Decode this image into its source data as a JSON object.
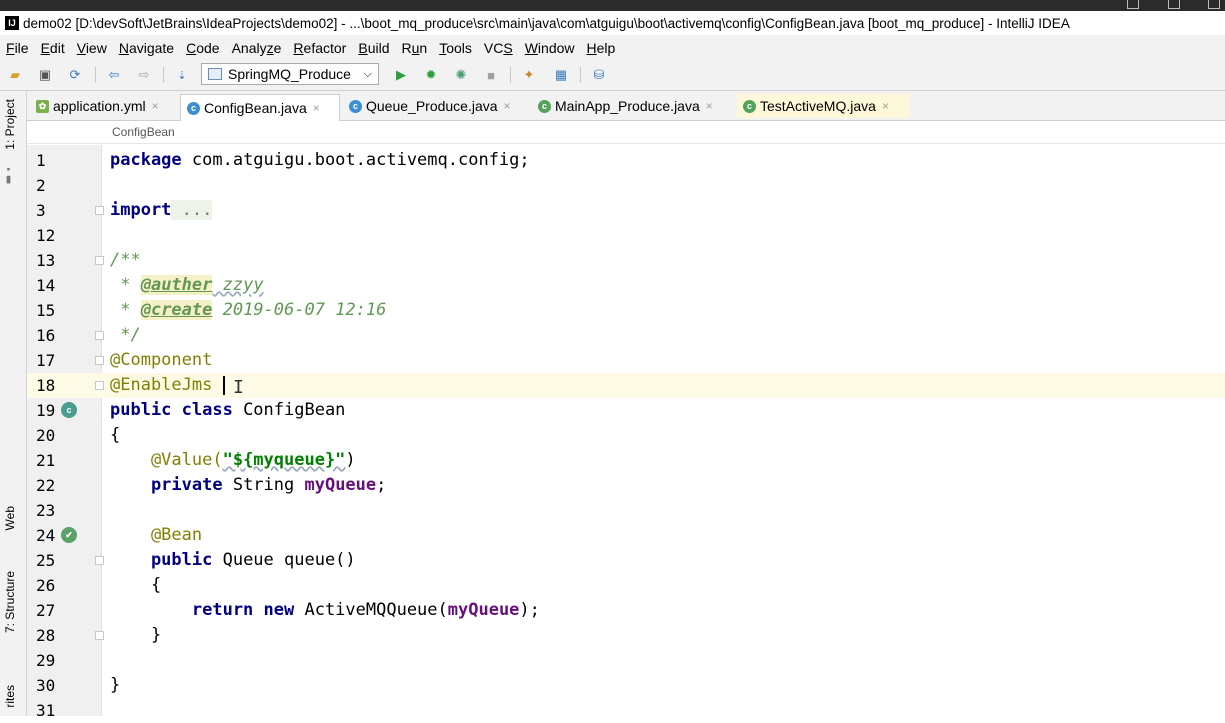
{
  "window": {
    "title": "demo02 [D:\\devSoft\\JetBrains\\IdeaProjects\\demo02] - ...\\boot_mq_produce\\src\\main\\java\\com\\atguigu\\boot\\activemq\\config\\ConfigBean.java [boot_mq_produce] - IntelliJ IDEA",
    "app_icon_text": "IJ"
  },
  "menu": {
    "items": [
      {
        "pre": "",
        "u": "F",
        "post": "ile"
      },
      {
        "pre": "",
        "u": "E",
        "post": "dit"
      },
      {
        "pre": "",
        "u": "V",
        "post": "iew"
      },
      {
        "pre": "",
        "u": "N",
        "post": "avigate"
      },
      {
        "pre": "",
        "u": "C",
        "post": "ode"
      },
      {
        "pre": "Analy",
        "u": "z",
        "post": "e"
      },
      {
        "pre": "",
        "u": "R",
        "post": "efactor"
      },
      {
        "pre": "",
        "u": "B",
        "post": "uild"
      },
      {
        "pre": "R",
        "u": "u",
        "post": "n"
      },
      {
        "pre": "",
        "u": "T",
        "post": "ools"
      },
      {
        "pre": "VC",
        "u": "S",
        "post": ""
      },
      {
        "pre": "",
        "u": "W",
        "post": "indow"
      },
      {
        "pre": "",
        "u": "H",
        "post": "elp"
      }
    ]
  },
  "toolbar": {
    "run_config": "SpringMQ_Produce"
  },
  "sidebar": {
    "project_tab": "1: Project",
    "web_tab": "Web",
    "structure_tab": "7: Structure",
    "favorites_tab": "rites"
  },
  "tabs": [
    {
      "label": "application.yml",
      "icon": "yml"
    },
    {
      "label": "ConfigBean.java",
      "icon": "class",
      "active": true
    },
    {
      "label": "Queue_Produce.java",
      "icon": "class"
    },
    {
      "label": "MainApp_Produce.java",
      "icon": "class"
    },
    {
      "label": "TestActiveMQ.java",
      "icon": "class"
    }
  ],
  "breadcrumb": "ConfigBean",
  "editor": {
    "line_numbers": [
      "1",
      "2",
      "3",
      "12",
      "13",
      "14",
      "15",
      "16",
      "17",
      "18",
      "19",
      "20",
      "21",
      "22",
      "23",
      "24",
      "25",
      "26",
      "27",
      "28",
      "29",
      "30",
      "31"
    ],
    "code": {
      "l1_kw": "package",
      "l1_rest": " com.atguigu.boot.activemq.config;",
      "l3_kw": "import",
      "l3_rest": " ...",
      "l13": "/**",
      "l14_pre": " * ",
      "l14_tag": "@auther",
      "l14_val": " zzyy",
      "l15_pre": " * ",
      "l15_tag": "@create",
      "l15_val": " 2019-06-07 12:16",
      "l16": " */",
      "l17": "@Component",
      "l18": "@EnableJms",
      "l19_kw": "public class",
      "l19_rest": " ConfigBean",
      "l20": "{",
      "l21_ann": "    @Value(",
      "l21_str": "\"${myqueue}\"",
      "l21_end": ")",
      "l22_kw": "    private",
      "l22_mid": " String ",
      "l22_field": "myQueue",
      "l22_end": ";",
      "l24": "    @Bean",
      "l25_kw": "    public",
      "l25_rest": " Queue queue()",
      "l26": "    {",
      "l27_kw": "        return new",
      "l27_mid": " ActiveMQQueue(",
      "l27_field": "myQueue",
      "l27_end": ");",
      "l28": "    }",
      "l30": "}"
    }
  }
}
